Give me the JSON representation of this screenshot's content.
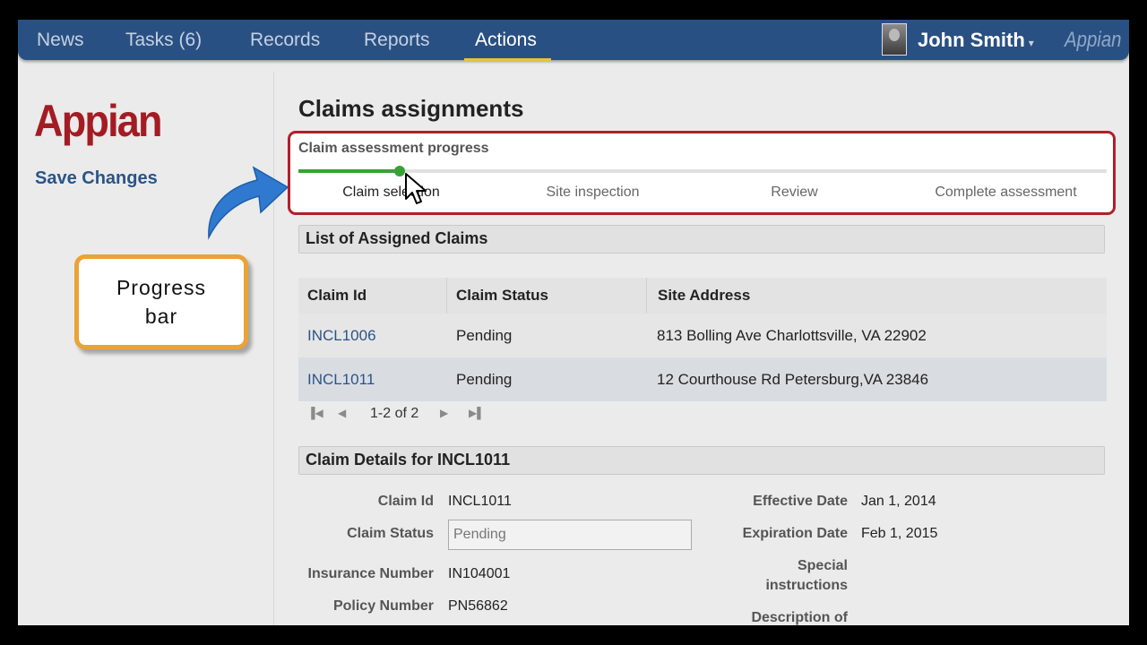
{
  "nav": {
    "tabs": [
      {
        "label": "News"
      },
      {
        "label": "Tasks (6)"
      },
      {
        "label": "Records"
      },
      {
        "label": "Reports"
      },
      {
        "label": "Actions"
      }
    ],
    "active_tab": "Actions",
    "user_name": "John Smith",
    "user_caret": "▾",
    "brand": "Appian",
    "colors": {
      "bar": "#295083",
      "active_underline": "#e6c23a"
    }
  },
  "sidebar": {
    "logo": "Appian",
    "save_label": "Save Changes"
  },
  "callout": {
    "text": "Progress bar"
  },
  "page": {
    "title": "Claims assignments"
  },
  "progress": {
    "title": "Claim assessment progress",
    "fraction_complete": 0.125,
    "steps": [
      {
        "label": "Claim selection"
      },
      {
        "label": "Site inspection"
      },
      {
        "label": "Review"
      },
      {
        "label": "Complete assessment"
      }
    ],
    "current_step_index": 0,
    "colors": {
      "border": "#b0202a",
      "fill": "#36a236"
    }
  },
  "claims_list": {
    "header": "List of Assigned Claims",
    "columns": [
      "Claim Id",
      "Claim Status",
      "Site Address"
    ],
    "rows": [
      {
        "id": "INCL1006",
        "status": "Pending",
        "address": "813 Bolling Ave Charlottsville, VA 22902"
      },
      {
        "id": "INCL1011",
        "status": "Pending",
        "address": "12 Courthouse Rd Petersburg,VA 23846"
      }
    ],
    "pager": {
      "label": "1-2 of 2"
    }
  },
  "details": {
    "header": "Claim Details for INCL1011",
    "claim_id_label": "Claim Id",
    "claim_id_value": "INCL1011",
    "claim_status_label": "Claim Status",
    "claim_status_value": "Pending",
    "insurance_number_label": "Insurance Number",
    "insurance_number_value": "IN104001",
    "policy_number_label": "Policy Number",
    "policy_number_value": "PN56862",
    "effective_date_label": "Effective Date",
    "effective_date_value": "Jan 1, 2014",
    "expiration_date_label": "Expiration Date",
    "expiration_date_value": "Feb 1, 2015",
    "special_instructions_label_line1": "Special",
    "special_instructions_label_line2": "instructions",
    "description_label": "Description of"
  }
}
